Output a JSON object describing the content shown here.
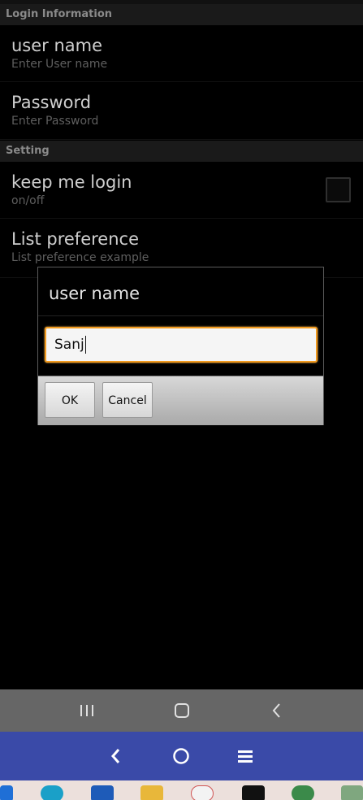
{
  "preferences": {
    "login_category": "Login Information",
    "username_title": "user name",
    "username_summary": "Enter User name",
    "password_title": "Password",
    "password_summary": "Enter Password",
    "setting_category": "Setting",
    "keep_login_title": "keep me login",
    "keep_login_summary": "on/off",
    "keep_login_checked": false,
    "list_pref_title": "List preference",
    "list_pref_summary": "List preference example"
  },
  "dialog": {
    "title": "user name",
    "input_value": "Sanj",
    "ok_label": "OK",
    "cancel_label": "Cancel"
  },
  "colors": {
    "accent_focus": "#f19a1f",
    "nav_primary": "#3a4aa8",
    "nav_secondary": "#666666"
  },
  "icons": {
    "recents": "recents-icon",
    "home": "home-icon",
    "back": "back-icon",
    "menu": "menu-icon"
  }
}
